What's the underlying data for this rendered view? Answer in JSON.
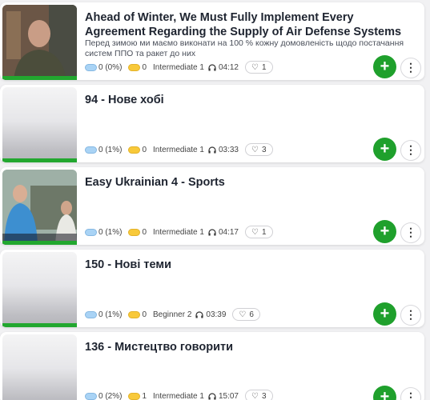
{
  "lessons": [
    {
      "title": "Ahead of Winter, We Must Fully Implement Every Agreement Regarding the Supply of Air Defense Systems",
      "subtitle": "Перед зимою ми маємо виконати на 100 % кожну домовленість щодо постачання систем ППО та ракет до них",
      "known_words": "0 (0%)",
      "learning_words": "0",
      "level": "Intermediate 1",
      "duration": "04:12",
      "likes": "1",
      "thumbnail": "photo-person"
    },
    {
      "title": "94 - Нове хобі",
      "subtitle": "",
      "known_words": "0 (1%)",
      "learning_words": "0",
      "level": "Intermediate 1",
      "duration": "03:33",
      "likes": "3",
      "thumbnail": "blank"
    },
    {
      "title": "Easy Ukrainian 4 - Sports",
      "subtitle": "",
      "known_words": "0 (1%)",
      "learning_words": "0",
      "level": "Intermediate 1",
      "duration": "04:17",
      "likes": "1",
      "thumbnail": "photo-outdoor"
    },
    {
      "title": "150 - Нові теми",
      "subtitle": "",
      "known_words": "0 (1%)",
      "learning_words": "0",
      "level": "Beginner 2",
      "duration": "03:39",
      "likes": "6",
      "thumbnail": "blank"
    },
    {
      "title": "136 - Мистецтво говорити",
      "subtitle": "",
      "known_words": "0 (2%)",
      "learning_words": "1",
      "level": "Intermediate 1",
      "duration": "15:07",
      "likes": "3",
      "thumbnail": "blank"
    }
  ],
  "icons": {
    "add": "+",
    "more": "⋮",
    "heart": "♡"
  },
  "colors": {
    "accent_green": "#1fa02c",
    "known_blue": "#a9d3f5",
    "learning_yellow": "#f8c93a"
  }
}
